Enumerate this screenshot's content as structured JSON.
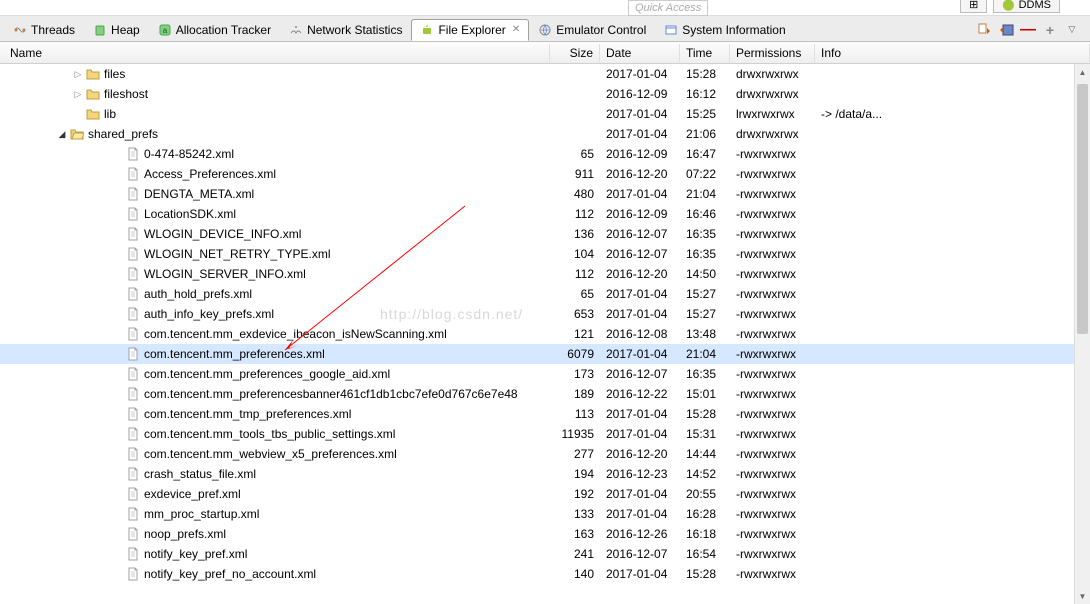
{
  "top": {
    "quick_access": "Quick Access",
    "ddms": "DDMS"
  },
  "tabs": [
    {
      "label": "Threads",
      "icon": "threads"
    },
    {
      "label": "Heap",
      "icon": "heap"
    },
    {
      "label": "Allocation Tracker",
      "icon": "alloc"
    },
    {
      "label": "Network Statistics",
      "icon": "network"
    },
    {
      "label": "File Explorer",
      "icon": "android",
      "active": true,
      "closable": true
    },
    {
      "label": "Emulator Control",
      "icon": "emulator"
    },
    {
      "label": "System Information",
      "icon": "sysinfo"
    }
  ],
  "columns": {
    "name": "Name",
    "size": "Size",
    "date": "Date",
    "time": "Time",
    "perms": "Permissions",
    "info": "Info"
  },
  "tree": [
    {
      "type": "folder",
      "name": "files",
      "indent": 72,
      "expander": "closed",
      "date": "2017-01-04",
      "time": "15:28",
      "perms": "drwxrwxrwx"
    },
    {
      "type": "folder",
      "name": "fileshost",
      "indent": 72,
      "expander": "closed",
      "date": "2016-12-09",
      "time": "16:12",
      "perms": "drwxrwxrwx"
    },
    {
      "type": "folder",
      "name": "lib",
      "indent": 72,
      "expander": "none",
      "date": "2017-01-04",
      "time": "15:25",
      "perms": "lrwxrwxrwx",
      "info": "-> /data/a..."
    },
    {
      "type": "folder",
      "name": "shared_prefs",
      "indent": 56,
      "expander": "open",
      "date": "2017-01-04",
      "time": "21:06",
      "perms": "drwxrwxrwx"
    },
    {
      "type": "file",
      "name": "0-474-85242.xml",
      "indent": 112,
      "size": "65",
      "date": "2016-12-09",
      "time": "16:47",
      "perms": "-rwxrwxrwx"
    },
    {
      "type": "file",
      "name": "Access_Preferences.xml",
      "indent": 112,
      "size": "911",
      "date": "2016-12-20",
      "time": "07:22",
      "perms": "-rwxrwxrwx"
    },
    {
      "type": "file",
      "name": "DENGTA_META.xml",
      "indent": 112,
      "size": "480",
      "date": "2017-01-04",
      "time": "21:04",
      "perms": "-rwxrwxrwx"
    },
    {
      "type": "file",
      "name": "LocationSDK.xml",
      "indent": 112,
      "size": "112",
      "date": "2016-12-09",
      "time": "16:46",
      "perms": "-rwxrwxrwx"
    },
    {
      "type": "file",
      "name": "WLOGIN_DEVICE_INFO.xml",
      "indent": 112,
      "size": "136",
      "date": "2016-12-07",
      "time": "16:35",
      "perms": "-rwxrwxrwx"
    },
    {
      "type": "file",
      "name": "WLOGIN_NET_RETRY_TYPE.xml",
      "indent": 112,
      "size": "104",
      "date": "2016-12-07",
      "time": "16:35",
      "perms": "-rwxrwxrwx"
    },
    {
      "type": "file",
      "name": "WLOGIN_SERVER_INFO.xml",
      "indent": 112,
      "size": "112",
      "date": "2016-12-20",
      "time": "14:50",
      "perms": "-rwxrwxrwx"
    },
    {
      "type": "file",
      "name": "auth_hold_prefs.xml",
      "indent": 112,
      "size": "65",
      "date": "2017-01-04",
      "time": "15:27",
      "perms": "-rwxrwxrwx"
    },
    {
      "type": "file",
      "name": "auth_info_key_prefs.xml",
      "indent": 112,
      "size": "653",
      "date": "2017-01-04",
      "time": "15:27",
      "perms": "-rwxrwxrwx"
    },
    {
      "type": "file",
      "name": "com.tencent.mm_exdevice_ibeacon_isNewScanning.xml",
      "indent": 112,
      "size": "121",
      "date": "2016-12-08",
      "time": "13:48",
      "perms": "-rwxrwxrwx"
    },
    {
      "type": "file",
      "name": "com.tencent.mm_preferences.xml",
      "indent": 112,
      "size": "6079",
      "date": "2017-01-04",
      "time": "21:04",
      "perms": "-rwxrwxrwx",
      "selected": true
    },
    {
      "type": "file",
      "name": "com.tencent.mm_preferences_google_aid.xml",
      "indent": 112,
      "size": "173",
      "date": "2016-12-07",
      "time": "16:35",
      "perms": "-rwxrwxrwx"
    },
    {
      "type": "file",
      "name": "com.tencent.mm_preferencesbanner461cf1db1cbc7efe0d767c6e7e48",
      "indent": 112,
      "size": "189",
      "date": "2016-12-22",
      "time": "15:01",
      "perms": "-rwxrwxrwx"
    },
    {
      "type": "file",
      "name": "com.tencent.mm_tmp_preferences.xml",
      "indent": 112,
      "size": "113",
      "date": "2017-01-04",
      "time": "15:28",
      "perms": "-rwxrwxrwx"
    },
    {
      "type": "file",
      "name": "com.tencent.mm_tools_tbs_public_settings.xml",
      "indent": 112,
      "size": "11935",
      "date": "2017-01-04",
      "time": "15:31",
      "perms": "-rwxrwxrwx"
    },
    {
      "type": "file",
      "name": "com.tencent.mm_webview_x5_preferences.xml",
      "indent": 112,
      "size": "277",
      "date": "2016-12-20",
      "time": "14:44",
      "perms": "-rwxrwxrwx"
    },
    {
      "type": "file",
      "name": "crash_status_file.xml",
      "indent": 112,
      "size": "194",
      "date": "2016-12-23",
      "time": "14:52",
      "perms": "-rwxrwxrwx"
    },
    {
      "type": "file",
      "name": "exdevice_pref.xml",
      "indent": 112,
      "size": "192",
      "date": "2017-01-04",
      "time": "20:55",
      "perms": "-rwxrwxrwx"
    },
    {
      "type": "file",
      "name": "mm_proc_startup.xml",
      "indent": 112,
      "size": "133",
      "date": "2017-01-04",
      "time": "16:28",
      "perms": "-rwxrwxrwx"
    },
    {
      "type": "file",
      "name": "noop_prefs.xml",
      "indent": 112,
      "size": "163",
      "date": "2016-12-26",
      "time": "16:18",
      "perms": "-rwxrwxrwx"
    },
    {
      "type": "file",
      "name": "notify_key_pref.xml",
      "indent": 112,
      "size": "241",
      "date": "2016-12-07",
      "time": "16:54",
      "perms": "-rwxrwxrwx"
    },
    {
      "type": "file",
      "name": "notify_key_pref_no_account.xml",
      "indent": 112,
      "size": "140",
      "date": "2017-01-04",
      "time": "15:28",
      "perms": "-rwxrwxrwx"
    }
  ],
  "watermark": "http://blog.csdn.net/"
}
